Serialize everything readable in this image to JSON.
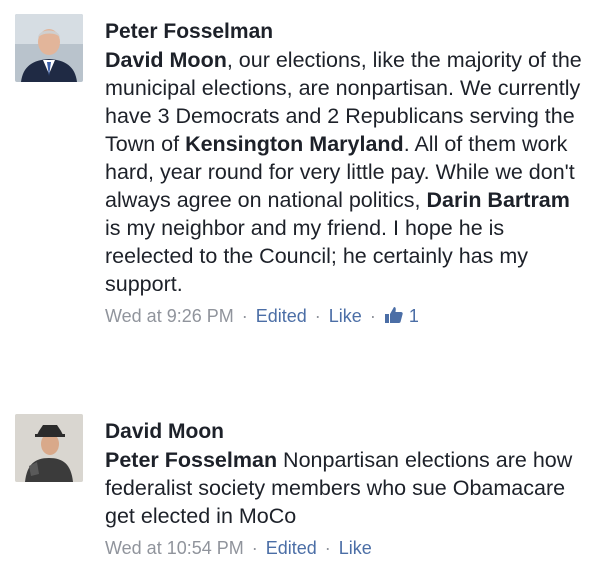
{
  "comments": [
    {
      "author": "Peter Fosselman",
      "avatar_icon": "user-avatar-photo",
      "segments": [
        {
          "text": "David Moon",
          "bold": true
        },
        {
          "text": ", our elections, like the majority of the municipal elections, are nonpartisan. We currently have 3 Democrats and 2 Republicans serving the Town of ",
          "bold": false
        },
        {
          "text": "Kensington Maryland",
          "bold": true
        },
        {
          "text": ". All of them work hard, year round for very little pay. While we don't always agree on national politics, ",
          "bold": false
        },
        {
          "text": "Darin Bartram",
          "bold": true
        },
        {
          "text": " is my neighbor and my friend. I hope he is reelected to the Council; he certainly has my support.",
          "bold": false
        }
      ],
      "timestamp": "Wed at 9:26 PM",
      "edited_label": "Edited",
      "like_label": "Like",
      "like_icon": "thumbs-up-icon",
      "like_count": "1"
    },
    {
      "author": "David Moon",
      "avatar_icon": "user-avatar-photo",
      "segments": [
        {
          "text": "Peter Fosselman",
          "bold": true
        },
        {
          "text": " Nonpartisan elections are how federalist society members who sue Obamacare get elected in MoCo",
          "bold": false
        }
      ],
      "timestamp": "Wed at 10:54 PM",
      "edited_label": "Edited",
      "like_label": "Like"
    }
  ],
  "colors": {
    "text": "#1d2129",
    "meta": "#90949c",
    "link": "#4b6ea6"
  }
}
